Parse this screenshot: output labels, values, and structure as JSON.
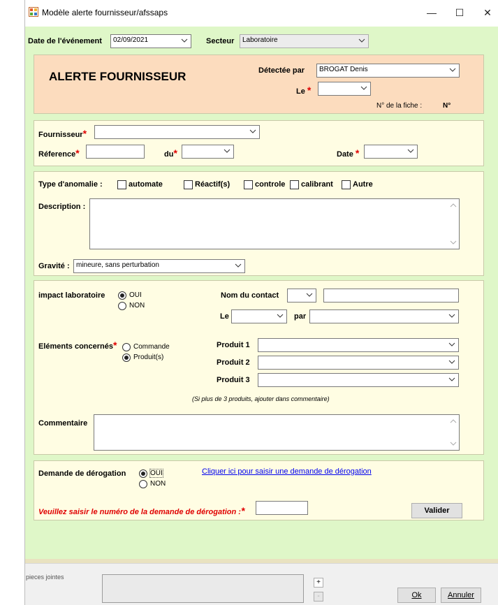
{
  "window": {
    "title": "Modèle alerte fournisseur/afssaps",
    "controls": {
      "minimize": "—",
      "maximize": "☐",
      "close": "✕"
    }
  },
  "header": {
    "date_label": "Date de l'événement",
    "date_value": "02/09/2021",
    "secteur_label": "Secteur",
    "secteur_value": "Laboratoire"
  },
  "alert": {
    "title": "ALERTE FOURNISSEUR",
    "detectee_label": "Détectée par",
    "detectee_value": "BROGAT Denis",
    "le_label": "Le",
    "le_value": "",
    "fiche_label": "N° de la fiche :",
    "fiche_value": "N°"
  },
  "fournisseur": {
    "fournisseur_label": "Fournisseur",
    "fournisseur_value": "",
    "reference_label": "Réference",
    "reference_value": "",
    "du_label": "du",
    "du_value": "",
    "date_label": "Date",
    "date_value": ""
  },
  "anomalie": {
    "type_label": "Type d'anomalie :",
    "options": [
      {
        "label": "automate",
        "checked": false
      },
      {
        "label": "Réactif(s)",
        "checked": false
      },
      {
        "label": "controle",
        "checked": false
      },
      {
        "label": "calibrant",
        "checked": false
      },
      {
        "label": "Autre",
        "checked": false
      }
    ],
    "description_label": "Description :",
    "description_value": "",
    "gravite_label": "Gravité :",
    "gravite_value": "mineure, sans perturbation"
  },
  "impact": {
    "label": "impact laboratoire",
    "oui": "OUI",
    "non": "NON",
    "selected": "OUI",
    "contact_label": "Nom du contact",
    "contact_combo": "",
    "contact_value": "",
    "le_label": "Le",
    "le_value": "",
    "par_label": "par",
    "par_value": "",
    "elements_label": "Eléments concernés",
    "commande": "Commande",
    "produits": "Produit(s)",
    "elements_selected": "Produit(s)",
    "produit1_label": "Produit 1",
    "produit1_value": "",
    "produit2_label": "Produit 2",
    "produit2_value": "",
    "produit3_label": "Produit 3",
    "produit3_value": "",
    "note": "(Si plus de 3 produits, ajouter dans commentaire)",
    "commentaire_label": "Commentaire",
    "commentaire_value": ""
  },
  "derogation": {
    "label": "Demande de dérogation",
    "oui": "OUI",
    "non": "NON",
    "selected": "OUI",
    "link": "Cliquer ici pour saisir une demande de dérogation",
    "numero_label": "Veuillez saisir le numéro de la demande de dérogation :",
    "numero_value": "",
    "valider": "Valider"
  },
  "footer": {
    "pieces_label": "pieces jointes",
    "add": "+",
    "remove": "-",
    "ok": "Ok",
    "annuler": "Annuler"
  },
  "colors": {
    "green_bg": "#dff7c8",
    "section_bg": "#fffde3",
    "alert_bg": "#fcdcbe",
    "required": "#e00000"
  }
}
